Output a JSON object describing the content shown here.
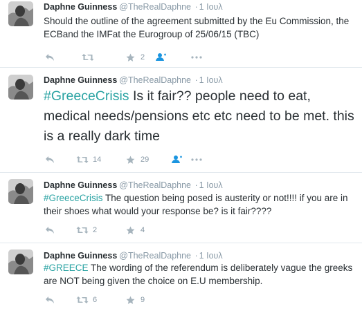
{
  "tweets": [
    {
      "name": "Daphne Guinness",
      "handle": "@TheRealDaphne",
      "sep": "·",
      "time": "1 Ιουλ",
      "parts": [
        {
          "t": "Should the outline of the agreement submitted by the Eu Commission, the ECBand the IMFat the Eurogroup of 25/06/15 (TBC)",
          "tag": false
        }
      ],
      "retweets": "",
      "favorites": "2"
    },
    {
      "name": "Daphne Guinness",
      "handle": "@TheRealDaphne",
      "sep": "·",
      "time": "1 Ιουλ",
      "parts": [
        {
          "t": "#GreeceCrisis",
          "tag": true
        },
        {
          "t": " Is it fair?? people need to eat, medical needs/pensions etc etc need to be met. this is a really dark time",
          "tag": false
        }
      ],
      "retweets": "14",
      "favorites": "29"
    },
    {
      "name": "Daphne Guinness",
      "handle": "@TheRealDaphne",
      "sep": "·",
      "time": "1 Ιουλ",
      "parts": [
        {
          "t": "#GreeceCrisis",
          "tag": true
        },
        {
          "t": " The question being posed is austerity or not!!!! if you are in their shoes what would your response be? is it fair????",
          "tag": false
        }
      ],
      "retweets": "2",
      "favorites": "4"
    },
    {
      "name": "Daphne Guinness",
      "handle": "@TheRealDaphne",
      "sep": "·",
      "time": "1 Ιουλ",
      "parts": [
        {
          "t": "#GREECE",
          "tag": true
        },
        {
          "t": " The wording of the referendum is deliberately vague the greeks are NOT being given the choice on E.U membership.",
          "tag": false
        }
      ],
      "retweets": "6",
      "favorites": "9"
    }
  ],
  "icons": {
    "reply": "reply-icon",
    "retweet": "retweet-icon",
    "favorite": "star-icon",
    "follow": "follow-icon",
    "more": "more-icon"
  },
  "colors": {
    "hashtag": "#2aa3a3",
    "follow_icon": "#1b95e0",
    "action_icon": "#a6b4bd",
    "muted_text": "#8899a6",
    "divider": "#e1e8ed"
  }
}
